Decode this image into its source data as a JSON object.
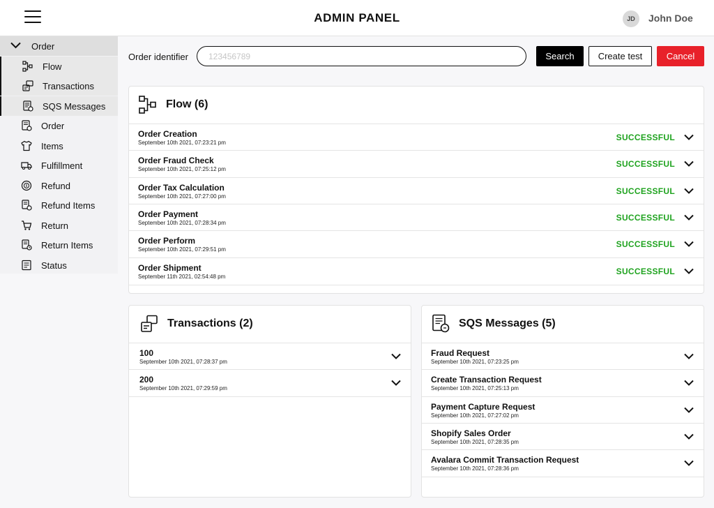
{
  "header": {
    "title": "ADMIN PANEL",
    "avatar_initials": "JD",
    "user_name": "John Doe"
  },
  "sidebar": {
    "parent": {
      "label": "Order",
      "icon": "chevron-down-icon"
    },
    "items": [
      {
        "label": "Flow",
        "icon": "flow-icon"
      },
      {
        "label": "Transactions",
        "icon": "transactions-icon"
      },
      {
        "label": "SQS Messages",
        "icon": "messages-icon"
      },
      {
        "label": "Order",
        "icon": "order-icon"
      },
      {
        "label": "Items",
        "icon": "shirt-icon"
      },
      {
        "label": "Fulfillment",
        "icon": "truck-icon"
      },
      {
        "label": "Refund",
        "icon": "refund-icon"
      },
      {
        "label": "Refund Items",
        "icon": "refund-items-icon"
      },
      {
        "label": "Return",
        "icon": "cart-icon"
      },
      {
        "label": "Return Items",
        "icon": "return-items-icon"
      },
      {
        "label": "Status",
        "icon": "status-icon"
      }
    ]
  },
  "search": {
    "label": "Order identifier",
    "placeholder": "123456789",
    "value": "",
    "search_button": "Search",
    "create_button": "Create test",
    "cancel_button": "Cancel"
  },
  "flow": {
    "title": "Flow (6)",
    "rows": [
      {
        "title": "Order Creation",
        "date": "September 10th 2021, 07:23:21 pm",
        "status": "SUCCESSFUL"
      },
      {
        "title": "Order Fraud Check",
        "date": "September 10th 2021, 07:25:12 pm",
        "status": "SUCCESSFUL"
      },
      {
        "title": "Order Tax Calculation",
        "date": "September 10th 2021, 07:27:00 pm",
        "status": "SUCCESSFUL"
      },
      {
        "title": "Order Payment",
        "date": "September 10th 2021, 07:28:34 pm",
        "status": "SUCCESSFUL"
      },
      {
        "title": "Order Perform",
        "date": "September 10th 2021, 07:29:51 pm",
        "status": "SUCCESSFUL"
      },
      {
        "title": "Order Shipment",
        "date": "September 11th 2021, 02:54:48 pm",
        "status": "SUCCESSFUL"
      }
    ]
  },
  "transactions": {
    "title": "Transactions (2)",
    "rows": [
      {
        "title": "100",
        "date": "September 10th 2021, 07:28:37 pm"
      },
      {
        "title": "200",
        "date": "September 10th 2021, 07:29:59 pm"
      }
    ]
  },
  "sqs": {
    "title": "SQS Messages (5)",
    "rows": [
      {
        "title": "Fraud Request",
        "date": "September 10th 2021, 07:23:25 pm"
      },
      {
        "title": "Create Transaction Request",
        "date": "September 10th 2021, 07:25:13 pm"
      },
      {
        "title": "Payment Capture Request",
        "date": "September 10th 2021, 07:27:02 pm"
      },
      {
        "title": "Shopify Sales Order",
        "date": "September 10th 2021, 07:28:35 pm"
      },
      {
        "title": "Avalara Commit Transaction Request",
        "date": "September 10th 2021, 07:28:36 pm"
      }
    ]
  },
  "colors": {
    "success": "#1fa31f",
    "cancel": "#e8212a",
    "primary": "#000000"
  }
}
